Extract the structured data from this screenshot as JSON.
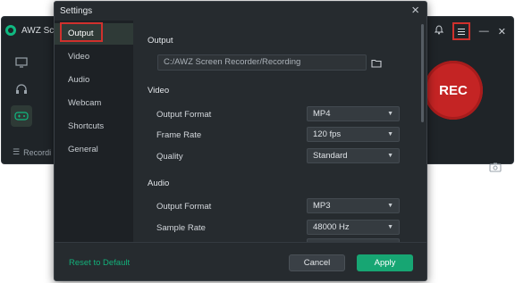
{
  "app": {
    "title": "AWZ Sc",
    "rec_label": "REC",
    "footer_label": "Recordi",
    "side_icons": [
      "monitor-icon",
      "headphones-icon",
      "gamepad-icon"
    ]
  },
  "dialog": {
    "title": "Settings",
    "nav": [
      {
        "label": "Output",
        "active": true
      },
      {
        "label": "Video",
        "active": false
      },
      {
        "label": "Audio",
        "active": false
      },
      {
        "label": "Webcam",
        "active": false
      },
      {
        "label": "Shortcuts",
        "active": false
      },
      {
        "label": "General",
        "active": false
      }
    ],
    "output": {
      "section_label": "Output",
      "path_value": "C:/AWZ Screen Recorder/Recording"
    },
    "video": {
      "section_label": "Video",
      "format_label": "Output Format",
      "format_value": "MP4",
      "framerate_label": "Frame Rate",
      "framerate_value": "120 fps",
      "quality_label": "Quality",
      "quality_value": "Standard"
    },
    "audio": {
      "section_label": "Audio",
      "format_label": "Output Format",
      "format_value": "MP3",
      "samplerate_label": "Sample Rate",
      "samplerate_value": "48000 Hz"
    },
    "footer": {
      "reset_label": "Reset to Default",
      "cancel_label": "Cancel",
      "apply_label": "Apply"
    }
  },
  "colors": {
    "accent": "#17a673",
    "highlight": "#d0312d",
    "rec": "#c42424"
  }
}
